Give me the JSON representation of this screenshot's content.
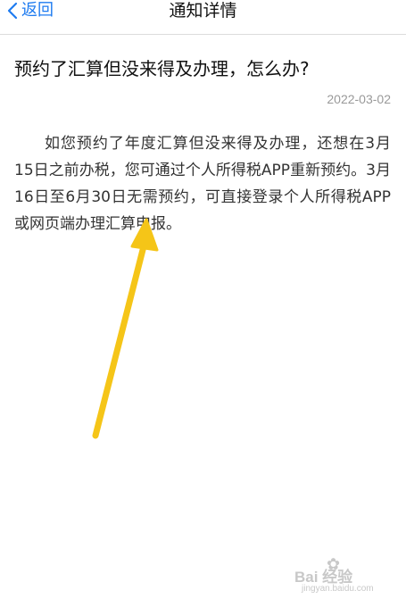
{
  "navbar": {
    "back_label": "返回",
    "title": "通知详情",
    "back_icon": "chevron-left-icon",
    "accent_color": "#1e7bf0"
  },
  "notice": {
    "title": "预约了汇算但没来得及办理，怎么办?",
    "date": "2022-03-02",
    "body": "如您预约了年度汇算但没来得及办理，还想在3月15日之前办税，您可通过个人所得税APP重新预约。3月16日至6月30日无需预约，可直接登录个人所得税APP或网页端办理汇算申报。"
  },
  "annotation": {
    "icon": "arrow-icon",
    "color": "#f5c518"
  },
  "watermark": {
    "brand": "Bai 经验",
    "domain": "jingyan.baidu.com"
  }
}
